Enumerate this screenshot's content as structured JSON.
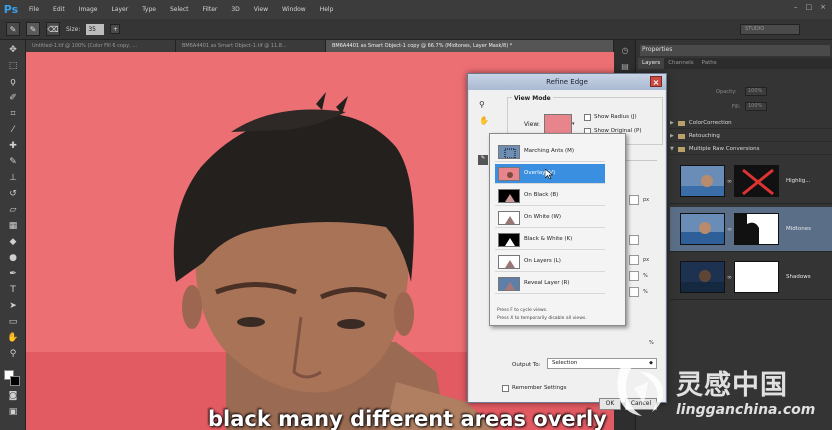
{
  "app": {
    "logo": "Ps"
  },
  "menu": [
    "File",
    "Edit",
    "Image",
    "Layer",
    "Type",
    "Select",
    "Filter",
    "3D",
    "View",
    "Window",
    "Help"
  ],
  "options": {
    "size_label": "Size:",
    "size_value": "35",
    "workspace": "STUDIO"
  },
  "tabs": [
    {
      "label": "Untitled-1.tif @ 100% (Color Fill 6 copy, ..."
    },
    {
      "label": "BM6A4401 as Smart Object-1.tif @ 11.8..."
    },
    {
      "label": "BM6A4401 as Smart Object-1 copy @ 66.7% (Midtones, Layer Mask/8) *"
    }
  ],
  "panel": {
    "header": "Properties",
    "tabs": [
      "Layers",
      "Channels",
      "Paths"
    ],
    "opacity_label": "Opacity:",
    "opacity_value": "100%",
    "fill_label": "Fill:",
    "fill_value": "100%",
    "groups": [
      "ColorCorrection",
      "Retouching",
      "Multiple Raw Conversions"
    ],
    "layers": [
      {
        "name": "Highlig...",
        "selected": false
      },
      {
        "name": "Midtones",
        "selected": true
      },
      {
        "name": "Shadows",
        "selected": false
      }
    ]
  },
  "dialog": {
    "title": "Refine Edge",
    "close": "×",
    "view_mode_label": "View Mode",
    "view_label": "View:",
    "show_radius": "Show Radius (J)",
    "show_original": "Show Original (P)",
    "unit_px": "px",
    "unit_pct": "%",
    "output_label": "Output To:",
    "output_value": "Selection",
    "remember": "Remember Settings",
    "ok": "OK",
    "cancel": "Cancel"
  },
  "view_options": [
    {
      "label": "Marching Ants (M)",
      "selected": false,
      "thumb": "ants"
    },
    {
      "label": "Overlay (V)",
      "selected": true,
      "thumb": "overlay"
    },
    {
      "label": "On Black (B)",
      "selected": false,
      "thumb": "black"
    },
    {
      "label": "On White (W)",
      "selected": false,
      "thumb": "white"
    },
    {
      "label": "Black & White (K)",
      "selected": false,
      "thumb": "bw"
    },
    {
      "label": "On Layers (L)",
      "selected": false,
      "thumb": "layers"
    },
    {
      "label": "Reveal Layer (R)",
      "selected": false,
      "thumb": "reveal"
    }
  ],
  "view_notes": [
    "Press F to cycle views.",
    "Press X to temporarily disable all views."
  ],
  "subtitle": "black many different areas overly",
  "watermark": {
    "cn": "灵感中国",
    "en": "lingganchina.com"
  },
  "colors": {
    "overlay": "#ec6f73",
    "selection": "#3b8fe0",
    "layer_selected": "#5a6e88"
  }
}
